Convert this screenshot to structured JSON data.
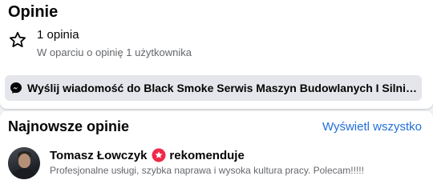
{
  "ratings": {
    "title": "Opinie",
    "count_label": "1 opinia",
    "sub_label": "W oparciu o opinię 1 użytkownika",
    "icon": "star-outline-icon"
  },
  "message_button": {
    "icon": "messenger-icon",
    "label": "Wyślij wiadomość do Black Smoke Serwis Maszyn Budowlanych I Silników"
  },
  "recent_reviews": {
    "title": "Najnowsze opinie",
    "see_all_label": "Wyświetl wszystko",
    "items": [
      {
        "reviewer": "Tomasz Łowczyk",
        "badge_icon": "recommend-icon",
        "verdict": "rekomenduje",
        "text": "Profesjonalne usługi, szybka naprawa i wysoka kultura pracy. Polecam!!!!!"
      }
    ]
  },
  "colors": {
    "link": "#216fdb",
    "secondary_text": "#65676b",
    "button_bg": "#e4e6eb",
    "recommend_red": "#f02849"
  }
}
